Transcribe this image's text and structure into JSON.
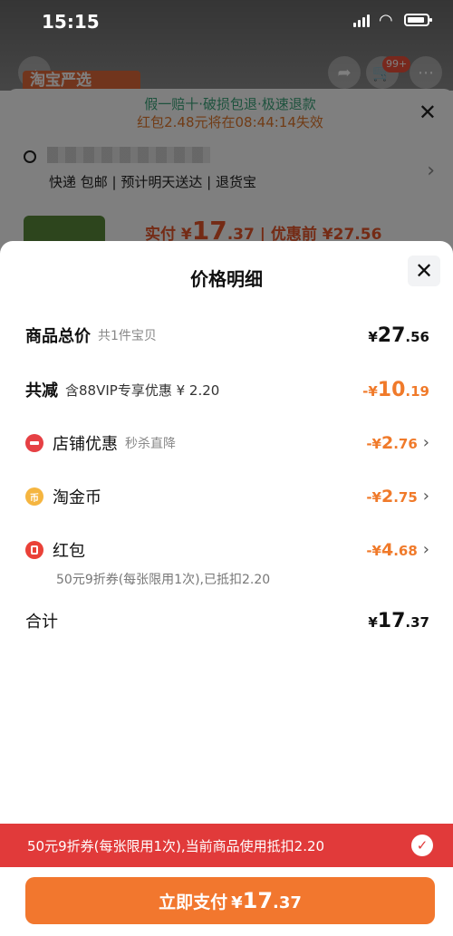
{
  "status_bar": {
    "time": "15:15"
  },
  "background": {
    "brand": "淘宝严选",
    "cart_badge": "99+",
    "guarantee": "假一赔十·破损包退·极速退款",
    "countdown": "红包2.48元将在08:44:14失效",
    "delivery": "快递 包邮 | 预计明天送达 | 退货宝",
    "price_label": "实付 ¥",
    "price_int": "17",
    "price_dec": ".37",
    "price_before": " | 优惠前 ¥27.56"
  },
  "sheet": {
    "title": "价格明细",
    "close_glyph": "✕",
    "rows": [
      {
        "label": "商品总价",
        "sub": "共1件宝贝",
        "currency": "¥",
        "int": "27",
        "dec": ".56"
      },
      {
        "label": "共减",
        "sub": "含88VIP专享优惠 ¥ 2.20",
        "currency": "-¥",
        "int": "10",
        "dec": ".19"
      },
      {
        "label": "店铺优惠",
        "sub": "秒杀直降",
        "currency": "-¥",
        "int": "2",
        "dec": ".76"
      },
      {
        "label": "淘金币",
        "sub": "",
        "currency": "-¥",
        "int": "2",
        "dec": ".75"
      },
      {
        "label": "红包",
        "sub": "",
        "currency": "-¥",
        "int": "4",
        "dec": ".68"
      },
      {
        "label": "合计",
        "sub": "",
        "currency": "¥",
        "int": "17",
        "dec": ".37"
      }
    ],
    "coupon_note": "50元9折券(每张限用1次),已抵扣2.20"
  },
  "notice": {
    "text": "50元9折券(每张限用1次),当前商品使用抵扣2.20",
    "check_glyph": "✓"
  },
  "pay_button": {
    "label": "立即支付",
    "currency": "¥",
    "int": "17",
    "dec": ".37"
  },
  "colors": {
    "accent_orange": "#f2772e",
    "notice_red": "#e13a3a",
    "discount_orange": "#f07a2a"
  }
}
